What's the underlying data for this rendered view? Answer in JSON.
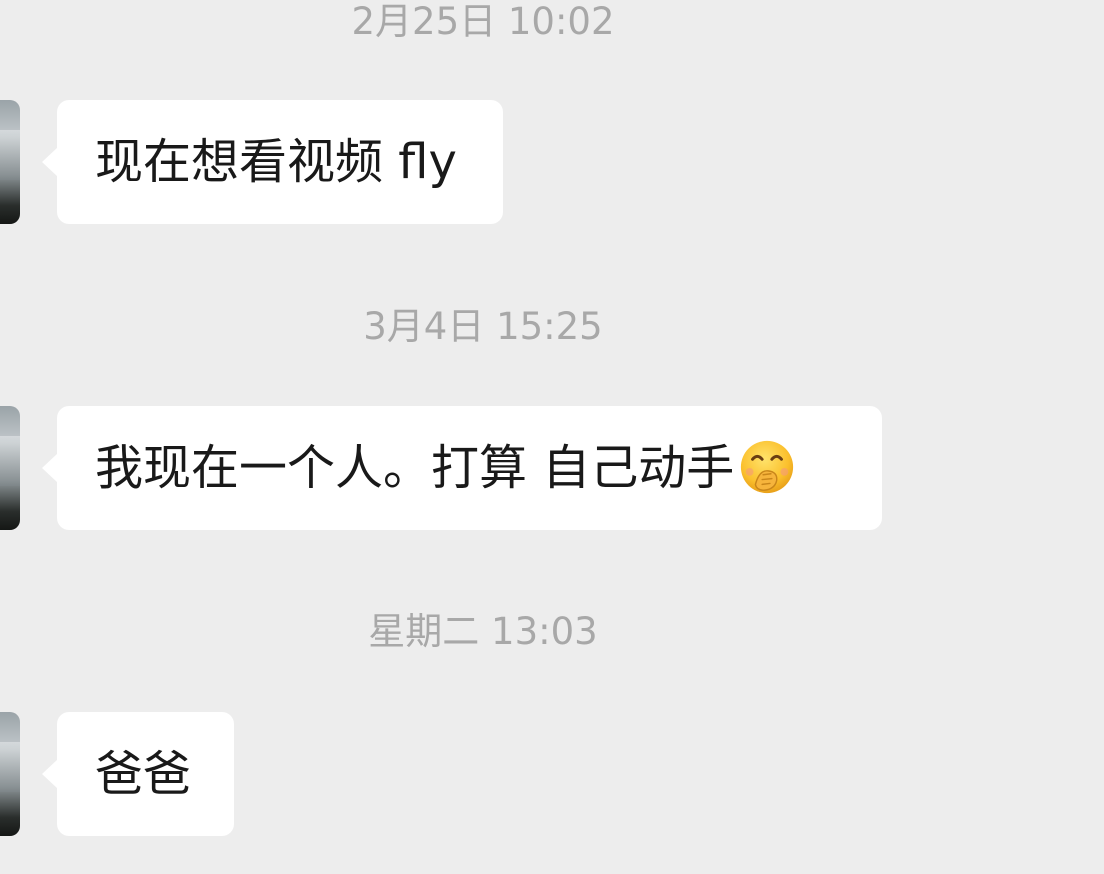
{
  "chat": {
    "messages": [
      {
        "timestamp": "2月25日 10:02",
        "text": "现在想看视频 fly",
        "emoji": ""
      },
      {
        "timestamp": "3月4日 15:25",
        "text": "我现在一个人。打算 自己动手",
        "emoji": "hand-over-mouth-emoji-icon"
      },
      {
        "timestamp": "星期二 13:03",
        "text": "爸爸",
        "emoji": ""
      }
    ]
  },
  "colors": {
    "background": "#ededed",
    "bubble": "#ffffff",
    "timestamp": "#a8a8a8",
    "text": "#191919"
  }
}
